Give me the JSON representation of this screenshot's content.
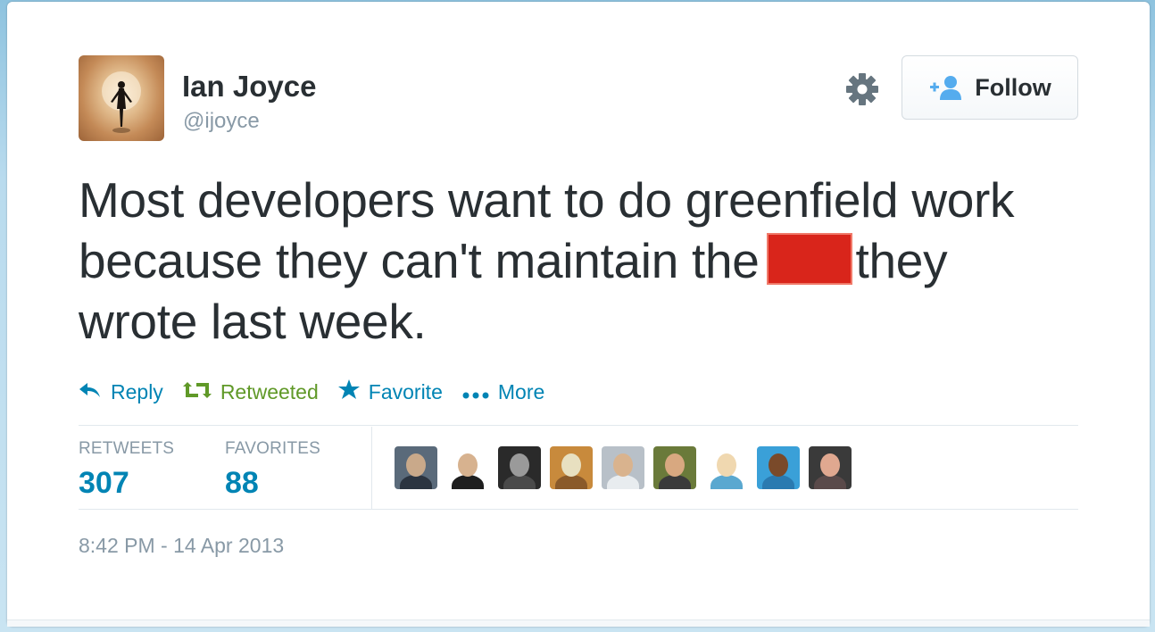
{
  "user": {
    "name": "Ian Joyce",
    "handle": "@ijoyce"
  },
  "follow_button": {
    "label": "Follow"
  },
  "tweet": {
    "text_part1": "Most developers want to do greenfield work because they can't maintain the",
    "text_part2": "they wrote last week.",
    "redaction_color": "#d9251b"
  },
  "actions": {
    "reply": "Reply",
    "retweeted": "Retweeted",
    "favorite": "Favorite",
    "more": "More"
  },
  "stats": {
    "retweets_label": "RETWEETS",
    "retweets_count": "307",
    "favorites_label": "FAVORITES",
    "favorites_count": "88"
  },
  "faces": [
    {
      "bg": "#5a6a7a",
      "head": "#c9a98a",
      "body": "#2b3440"
    },
    {
      "bg": "#ffffff",
      "head": "#d7b28f",
      "body": "#1e1e1e"
    },
    {
      "bg": "#2a2a2a",
      "head": "#9a9a9a",
      "body": "#4a4a4a"
    },
    {
      "bg": "#c88a3c",
      "head": "#e8e0c0",
      "body": "#8a5a2a"
    },
    {
      "bg": "#b8c0c8",
      "head": "#d9b38e",
      "body": "#e8ecef"
    },
    {
      "bg": "#6a7a3a",
      "head": "#d8a880",
      "body": "#3a3a3a"
    },
    {
      "bg": "#ffffff",
      "head": "#f0d8b0",
      "body": "#5aa8d0"
    },
    {
      "bg": "#3aa0d8",
      "head": "#7a4a2a",
      "body": "#2a7ab0"
    },
    {
      "bg": "#3a3a3a",
      "head": "#e0a890",
      "body": "#5a4a4a"
    }
  ],
  "timestamp": "8:42 PM - 14 Apr 2013",
  "colors": {
    "link_blue": "#0084b4",
    "retweet_green": "#609928",
    "muted": "#8899a6",
    "text": "#292f33"
  },
  "icons": [
    "gear-icon",
    "add-user-icon",
    "reply-icon",
    "retweet-icon",
    "star-icon",
    "more-dots-icon"
  ]
}
